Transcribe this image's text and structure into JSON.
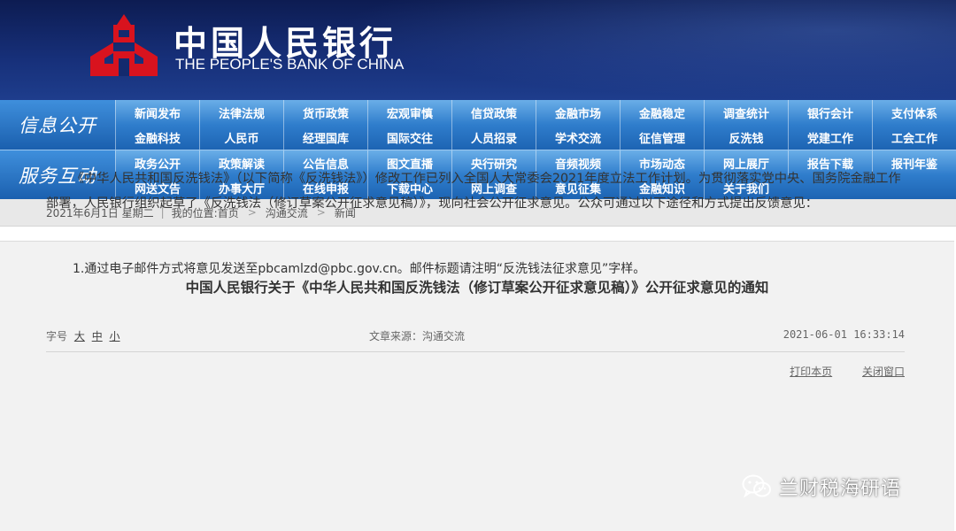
{
  "header": {
    "name_cn": "中国人民银行",
    "name_en": "THE PEOPLE'S BANK OF CHINA",
    "brand_color": "#d8131e",
    "bg_color": "#132a6e"
  },
  "nav": {
    "info_label": "信息公开",
    "service_label": "服务互动",
    "info_items": [
      "新闻发布",
      "法律法规",
      "货币政策",
      "宏观审慎",
      "信贷政策",
      "金融市场",
      "金融稳定",
      "调查统计",
      "银行会计",
      "支付体系",
      "金融科技",
      "人民币",
      "经理国库",
      "国际交往",
      "人员招录",
      "学术交流",
      "征信管理",
      "反洗钱",
      "党建工作",
      "工会工作"
    ],
    "service_items": [
      "政务公开",
      "政策解读",
      "公告信息",
      "图文直播",
      "央行研究",
      "音频视频",
      "市场动态",
      "网上展厅",
      "报告下载",
      "报刊年鉴",
      "网送文告",
      "办事大厅",
      "在线申报",
      "下载中心",
      "网上调查",
      "意见征集",
      "金融知识",
      "关于我们"
    ]
  },
  "breadcrumb": {
    "date": "2021年6月1日 星期二",
    "location_label": "我的位置:首页",
    "level1": "沟通交流",
    "level2": "新闻",
    "arrow": ">"
  },
  "article": {
    "title": "中国人民银行关于《中华人民共和国反洗钱法（修订草案公开征求意见稿）》公开征求意见的通知",
    "font_size_label": "字号",
    "size_large": "大",
    "size_medium": "中",
    "size_small": "小",
    "source": "文章来源：沟通交流",
    "datetime": "2021-06-01 16:33:14",
    "print_label": "打印本页",
    "close_label": "关闭窗口",
    "paragraph1": "《中华人民共和国反洗钱法》（以下简称《反洗钱法》）修改工作已列入全国人大常委会2021年度立法工作计划。为贯彻落实党中央、国务院金融工作部署，人民银行组织起草了《反洗钱法（修订草案公开征求意见稿）》，现向社会公开征求意见。公众可通过以下途径和方式提出反馈意见：",
    "item1": "1.通过电子邮件方式将意见发送至pbcamlzd@pbc.gov.cn。邮件标题请注明“反洗钱法征求意见”字样。"
  },
  "watermark": {
    "text": "兰财税海研语",
    "icon": "wechat-icon"
  }
}
